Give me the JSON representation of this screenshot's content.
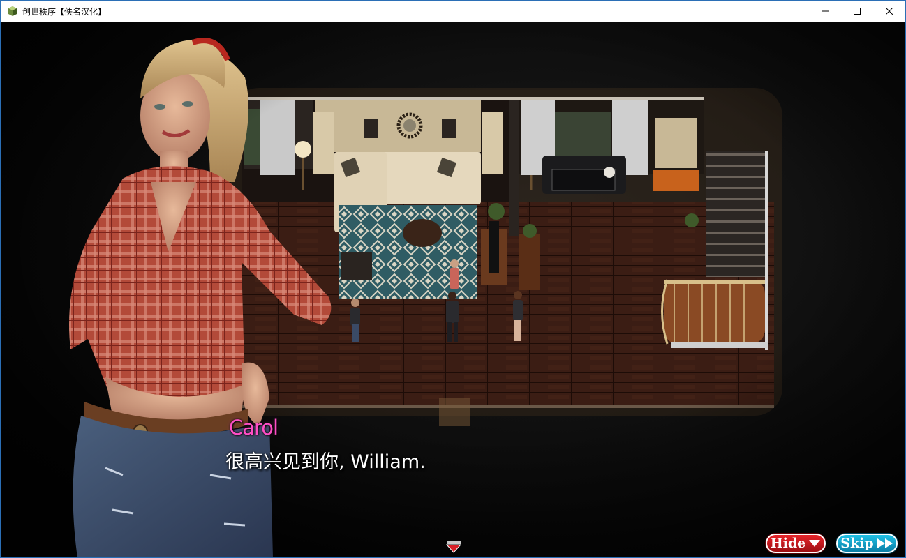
{
  "window": {
    "title": "创世秩序【佚名汉化】",
    "controls": {
      "minimize_icon": "minimize-icon",
      "maximize_icon": "maximize-icon",
      "close_icon": "close-icon"
    }
  },
  "dialogue": {
    "speaker": "Carol",
    "speaker_color": "#ff4fc6",
    "text": "很高兴见到你, William."
  },
  "quick_menu": {
    "hide_label": "Hide",
    "hide_color": "#d81f26",
    "hide_icon": "triangle-down-icon",
    "skip_label": "Skip",
    "skip_color": "#17a9d6",
    "skip_icon": "fast-forward-icon"
  },
  "scene": {
    "location": "house-living-room",
    "characters_on_map": 4,
    "portrait": "carol-portrait"
  }
}
